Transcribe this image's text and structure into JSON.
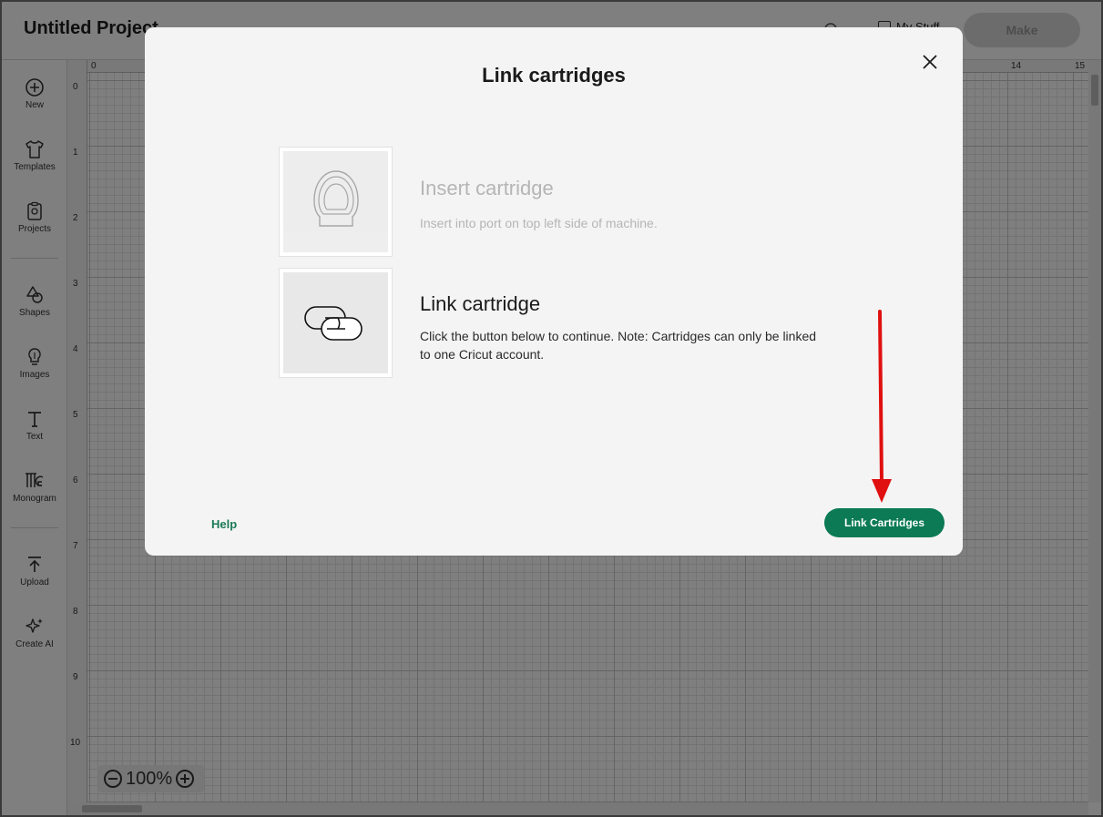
{
  "app": {
    "project_title": "Untitled Project",
    "my_stuff_label": "My Stuff",
    "make_label": "Make"
  },
  "sidebar": {
    "items": [
      {
        "label": "New",
        "icon": "plus-circle-icon"
      },
      {
        "label": "Templates",
        "icon": "shirt-icon"
      },
      {
        "label": "Projects",
        "icon": "clipboard-icon"
      },
      {
        "label": "Shapes",
        "icon": "shapes-icon"
      },
      {
        "label": "Images",
        "icon": "bulb-icon"
      },
      {
        "label": "Text",
        "icon": "text-t-icon"
      },
      {
        "label": "Monogram",
        "icon": "monogram-icon"
      },
      {
        "label": "Upload",
        "icon": "upload-icon"
      },
      {
        "label": "Create AI",
        "icon": "sparkle-icon"
      }
    ]
  },
  "canvas": {
    "ruler_top_ticks": [
      "0",
      "14",
      "15"
    ],
    "ruler_left_ticks": [
      "0",
      "1",
      "2",
      "3",
      "4",
      "5",
      "6",
      "7",
      "8",
      "9",
      "10"
    ],
    "zoom_level": "100%"
  },
  "modal": {
    "title": "Link cartridges",
    "steps": [
      {
        "title": "Insert cartridge",
        "description": "Insert into port on top left side of machine.",
        "icon": "cartridge-icon",
        "state": "inactive"
      },
      {
        "title": "Link cartridge",
        "description": "Click the button below to continue. Note: Cartridges can only be linked to one Cricut account.",
        "icon": "link-chain-icon",
        "state": "active"
      }
    ],
    "help_label": "Help",
    "primary_button_label": "Link Cartridges"
  },
  "colors": {
    "accent_green": "#0b7a55",
    "annotation_arrow": "#e01010"
  }
}
